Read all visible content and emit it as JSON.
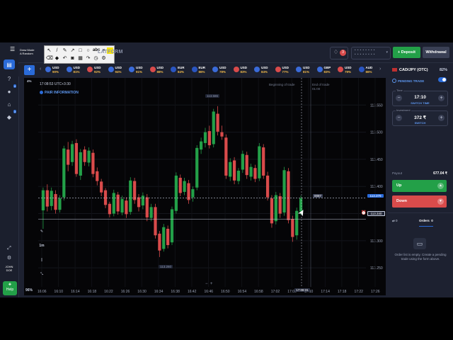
{
  "colors": {
    "bull": "#23a048",
    "bear": "#d94b4b",
    "accent": "#2a6bd9",
    "background": "#050507"
  },
  "sidebar": {
    "items": [
      {
        "name": "trade",
        "icon": "chart-icon"
      },
      {
        "name": "support",
        "icon": "help-icon"
      },
      {
        "name": "profile",
        "icon": "user-icon",
        "badge": "4"
      },
      {
        "name": "market",
        "icon": "cart-icon"
      },
      {
        "name": "achievements",
        "icon": "trophy-icon",
        "badge": "3"
      }
    ],
    "bottom": {
      "user_label": "JOHN\nDOE",
      "help_label": "Help",
      "expand_icon": "expand-icon",
      "settings_icon": "gear-icon"
    }
  },
  "header": {
    "logo_text": "Draw Mode\nA Random",
    "platform_label": "LATFORM",
    "notification_count": "3",
    "account_text": "• • • • • • • •\n• • • • • • • •",
    "deposit_label": "+ Deposit",
    "withdraw_label": "Withdrawal"
  },
  "asset_strip": {
    "assets": [
      {
        "name": "USD",
        "pct": "90%",
        "color": "#3a6bd9"
      },
      {
        "name": "USD",
        "pct": "81%",
        "color": "#3a6bd9"
      },
      {
        "name": "USD",
        "pct": "92%",
        "color": "#d94b4b"
      },
      {
        "name": "USD",
        "pct": "94%",
        "color": "#3a6bd9"
      },
      {
        "name": "USD",
        "pct": "91%",
        "color": "#3a6bd9"
      },
      {
        "name": "USD",
        "pct": "88%",
        "color": "#d94b4b"
      },
      {
        "name": "EUR",
        "pct": "84%",
        "color": "#2a55c0"
      },
      {
        "name": "EUR",
        "pct": "86%",
        "color": "#2a55c0"
      },
      {
        "name": "USD",
        "pct": "78%",
        "color": "#3a6bd9"
      },
      {
        "name": "USD",
        "pct": "83%",
        "color": "#d94b4b"
      },
      {
        "name": "USD",
        "pct": "84%",
        "color": "#3a6bd9"
      },
      {
        "name": "USD",
        "pct": "77%",
        "color": "#d94b4b"
      },
      {
        "name": "USD",
        "pct": "81%",
        "color": "#3a6bd9"
      },
      {
        "name": "GBP",
        "pct": "83%",
        "color": "#3a6bd9"
      },
      {
        "name": "USD",
        "pct": "79%",
        "color": "#d94b4b"
      },
      {
        "name": "AUD",
        "pct": "86%",
        "color": "#2a55c0"
      }
    ]
  },
  "chart": {
    "time_label": "17:08:53 UTC+3:30",
    "pair_info_label": "PAIR INFORMATION",
    "timeframe_label": "1m",
    "zoom_label": "96%",
    "top_pct": "4%",
    "beginning_label": "Beginning of trade",
    "end_label": "End of trade",
    "end_time": "01:00",
    "high_tag": "113.586",
    "low_tag": "113.260",
    "pending_tag": "0087",
    "cursor_time": "17:08:31",
    "current_price": "113.379",
    "line_price": "113.340"
  },
  "chart_data": {
    "type": "candlestick",
    "y_ticks": [
      "113.550",
      "113.500",
      "113.450",
      "113.400",
      "113.350",
      "113.300",
      "113.250"
    ],
    "x_ticks": [
      "16:06",
      "16:10",
      "16:14",
      "16:18",
      "16:22",
      "16:26",
      "16:30",
      "16:34",
      "16:38",
      "16:42",
      "16:46",
      "16:50",
      "16:54",
      "16:58",
      "17:02",
      "17:06",
      "17:10",
      "17:14",
      "17:18",
      "17:22",
      "17:26"
    ],
    "ylim": [
      113.215,
      113.6
    ],
    "candles": [
      {
        "o": 113.356,
        "c": 113.393,
        "h": 113.398,
        "l": 113.322
      },
      {
        "o": 113.393,
        "c": 113.363,
        "h": 113.404,
        "l": 113.354
      },
      {
        "o": 113.364,
        "c": 113.392,
        "h": 113.398,
        "l": 113.356
      },
      {
        "o": 113.386,
        "c": 113.357,
        "h": 113.393,
        "l": 113.35
      },
      {
        "o": 113.357,
        "c": 113.378,
        "h": 113.384,
        "l": 113.352
      },
      {
        "o": 113.38,
        "c": 113.47,
        "h": 113.475,
        "l": 113.374
      },
      {
        "o": 113.468,
        "c": 113.44,
        "h": 113.482,
        "l": 113.428
      },
      {
        "o": 113.445,
        "c": 113.478,
        "h": 113.484,
        "l": 113.438
      },
      {
        "o": 113.48,
        "c": 113.423,
        "h": 113.487,
        "l": 113.418
      },
      {
        "o": 113.42,
        "c": 113.463,
        "h": 113.469,
        "l": 113.412
      },
      {
        "o": 113.468,
        "c": 113.445,
        "h": 113.474,
        "l": 113.438
      },
      {
        "o": 113.444,
        "c": 113.466,
        "h": 113.472,
        "l": 113.437
      },
      {
        "o": 113.462,
        "c": 113.423,
        "h": 113.468,
        "l": 113.417
      },
      {
        "o": 113.428,
        "c": 113.41,
        "h": 113.435,
        "l": 113.402
      },
      {
        "o": 113.409,
        "c": 113.389,
        "h": 113.414,
        "l": 113.382
      },
      {
        "o": 113.393,
        "c": 113.366,
        "h": 113.397,
        "l": 113.36
      },
      {
        "o": 113.368,
        "c": 113.349,
        "h": 113.372,
        "l": 113.343
      },
      {
        "o": 113.35,
        "c": 113.388,
        "h": 113.394,
        "l": 113.345
      },
      {
        "o": 113.385,
        "c": 113.354,
        "h": 113.39,
        "l": 113.348
      },
      {
        "o": 113.352,
        "c": 113.377,
        "h": 113.383,
        "l": 113.347
      },
      {
        "o": 113.374,
        "c": 113.349,
        "h": 113.38,
        "l": 113.342
      },
      {
        "o": 113.353,
        "c": 113.411,
        "h": 113.417,
        "l": 113.348
      },
      {
        "o": 113.41,
        "c": 113.375,
        "h": 113.416,
        "l": 113.368
      },
      {
        "o": 113.38,
        "c": 113.362,
        "h": 113.386,
        "l": 113.354
      },
      {
        "o": 113.365,
        "c": 113.383,
        "h": 113.389,
        "l": 113.358
      },
      {
        "o": 113.38,
        "c": 113.343,
        "h": 113.386,
        "l": 113.336
      },
      {
        "o": 113.342,
        "c": 113.362,
        "h": 113.368,
        "l": 113.336
      },
      {
        "o": 113.362,
        "c": 113.31,
        "h": 113.368,
        "l": 113.304
      },
      {
        "o": 113.313,
        "c": 113.282,
        "h": 113.318,
        "l": 113.27
      },
      {
        "o": 113.285,
        "c": 113.325,
        "h": 113.331,
        "l": 113.28
      },
      {
        "o": 113.322,
        "c": 113.292,
        "h": 113.328,
        "l": 113.286
      },
      {
        "o": 113.297,
        "c": 113.358,
        "h": 113.363,
        "l": 113.292
      },
      {
        "o": 113.355,
        "c": 113.42,
        "h": 113.426,
        "l": 113.35
      },
      {
        "o": 113.416,
        "c": 113.388,
        "h": 113.422,
        "l": 113.382
      },
      {
        "o": 113.39,
        "c": 113.41,
        "h": 113.416,
        "l": 113.384
      },
      {
        "o": 113.406,
        "c": 113.375,
        "h": 113.412,
        "l": 113.368
      },
      {
        "o": 113.38,
        "c": 113.395,
        "h": 113.4,
        "l": 113.372
      },
      {
        "o": 113.398,
        "c": 113.471,
        "h": 113.476,
        "l": 113.393
      },
      {
        "o": 113.468,
        "c": 113.483,
        "h": 113.49,
        "l": 113.46
      },
      {
        "o": 113.48,
        "c": 113.5,
        "h": 113.508,
        "l": 113.472
      },
      {
        "o": 113.502,
        "c": 113.476,
        "h": 113.512,
        "l": 113.47
      },
      {
        "o": 113.478,
        "c": 113.538,
        "h": 113.543,
        "l": 113.472
      },
      {
        "o": 113.534,
        "c": 113.501,
        "h": 113.548,
        "l": 113.494
      },
      {
        "o": 113.5,
        "c": 113.492,
        "h": 113.512,
        "l": 113.486
      },
      {
        "o": 113.49,
        "c": 113.42,
        "h": 113.496,
        "l": 113.414
      },
      {
        "o": 113.418,
        "c": 113.445,
        "h": 113.452,
        "l": 113.41
      },
      {
        "o": 113.448,
        "c": 113.411,
        "h": 113.454,
        "l": 113.404
      },
      {
        "o": 113.41,
        "c": 113.429,
        "h": 113.434,
        "l": 113.404
      },
      {
        "o": 113.431,
        "c": 113.46,
        "h": 113.466,
        "l": 113.425
      },
      {
        "o": 113.458,
        "c": 113.421,
        "h": 113.464,
        "l": 113.414
      },
      {
        "o": 113.418,
        "c": 113.436,
        "h": 113.442,
        "l": 113.411
      },
      {
        "o": 113.434,
        "c": 113.414,
        "h": 113.44,
        "l": 113.408
      },
      {
        "o": 113.415,
        "c": 113.474,
        "h": 113.48,
        "l": 113.41
      },
      {
        "o": 113.472,
        "c": 113.42,
        "h": 113.478,
        "l": 113.414
      },
      {
        "o": 113.42,
        "c": 113.38,
        "h": 113.427,
        "l": 113.374
      },
      {
        "o": 113.378,
        "c": 113.332,
        "h": 113.384,
        "l": 113.324
      },
      {
        "o": 113.336,
        "c": 113.384,
        "h": 113.39,
        "l": 113.33
      },
      {
        "o": 113.382,
        "c": 113.35,
        "h": 113.388,
        "l": 113.342
      },
      {
        "o": 113.352,
        "c": 113.43,
        "h": 113.436,
        "l": 113.346
      },
      {
        "o": 113.428,
        "c": 113.338,
        "h": 113.434,
        "l": 113.332
      },
      {
        "o": 113.34,
        "c": 113.307,
        "h": 113.346,
        "l": 113.298
      },
      {
        "o": 113.31,
        "c": 113.355,
        "h": 113.361,
        "l": 113.302
      },
      {
        "o": 113.354,
        "c": 113.378,
        "h": 113.383,
        "l": 113.348
      }
    ],
    "current_price": 113.379,
    "line_price": 113.34
  },
  "right_panel": {
    "pair": "CAD/JPY (OTC)",
    "payout_pct": "82%",
    "pending_trade_label": "PENDING TRADE",
    "time_label": "Time",
    "time_value": "17:10",
    "switch_time_label": "SWITCH TIME",
    "amount_label": "Investment",
    "amount_value": "372 ₹",
    "switch_label": "SWITCH",
    "payout_label": "Payout",
    "payout_value": "677.04 ₹",
    "up_label": "Up",
    "down_label": "Down",
    "tab_left_count": "0",
    "orders_label": "Orders",
    "orders_count": "0",
    "empty_text": "Order list is empty. Create a pending trade using the form above."
  }
}
